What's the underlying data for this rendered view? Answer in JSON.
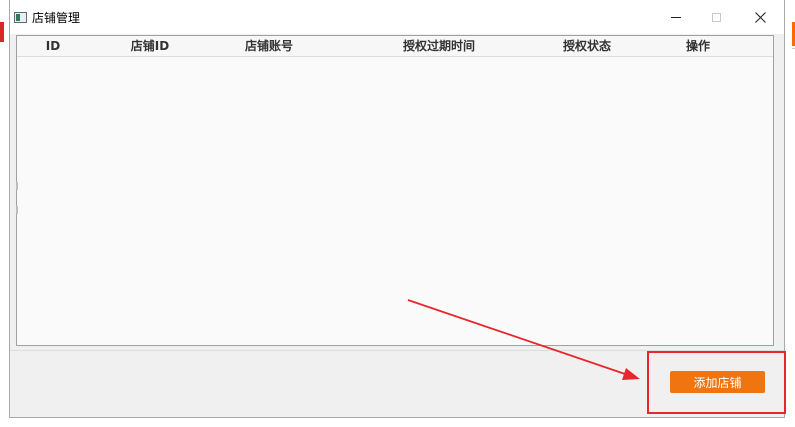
{
  "window": {
    "title": "店铺管理"
  },
  "table": {
    "columns": [
      "ID",
      "店铺ID",
      "店铺账号",
      "授权过期时间",
      "授权状态",
      "操作"
    ],
    "rows": []
  },
  "actions": {
    "add_store_label": "添加店铺"
  },
  "colors": {
    "accent": "#f07511",
    "annotation": "#e8262b",
    "window_bg": "#f0f0f0"
  },
  "icons": {
    "app": "window-app-icon",
    "minimize": "minimize-icon",
    "maximize": "maximize-icon",
    "close": "close-icon"
  }
}
